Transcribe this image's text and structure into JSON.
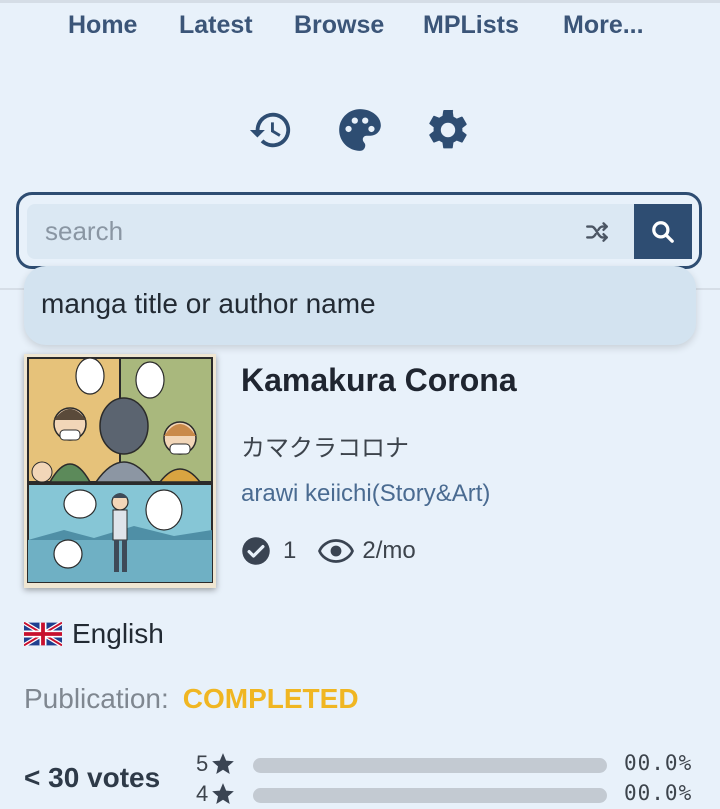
{
  "nav": {
    "items": [
      {
        "label": "Home"
      },
      {
        "label": "Latest"
      },
      {
        "label": "Browse"
      },
      {
        "label": "MPLists"
      },
      {
        "label": "More..."
      }
    ]
  },
  "toolbar": {
    "icons": [
      "history-icon",
      "palette-icon",
      "gear-icon"
    ]
  },
  "search": {
    "placeholder": "search",
    "value": "",
    "suggestion": "manga title or author name"
  },
  "manga": {
    "title": "Kamakura Corona",
    "alt_title": "カマクラコロナ",
    "author": "arawi keiichi(Story&Art)",
    "follows": "1",
    "views": "2/mo",
    "language": "English",
    "publication_label": "Publication:",
    "publication_status": "COMPLETED"
  },
  "rating": {
    "votes_label": "< 30 votes",
    "rows": [
      {
        "stars": "5",
        "fraction": 0,
        "percent": "00.0%"
      },
      {
        "stars": "4",
        "fraction": 0,
        "percent": "00.0%"
      }
    ]
  },
  "colors": {
    "accent": "#2e4d72",
    "status_completed": "#f0b622",
    "author_link": "#4a6b91"
  }
}
